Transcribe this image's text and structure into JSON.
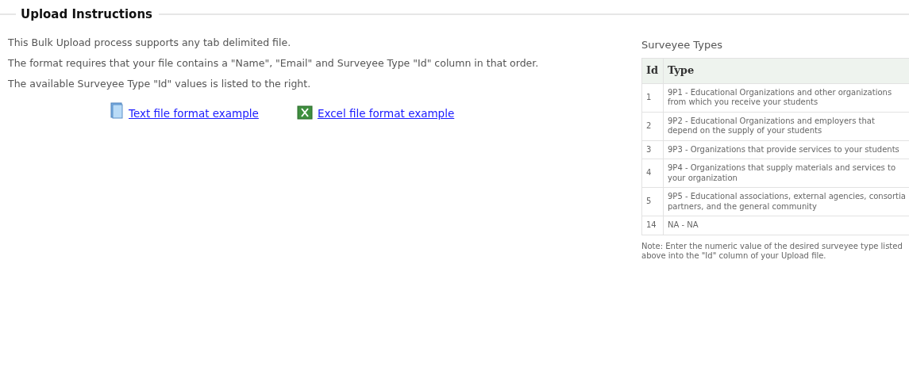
{
  "section": {
    "title": "Upload Instructions"
  },
  "instructions": [
    "This Bulk Upload process supports any tab delimited file.",
    "The format requires that your file contains a \"Name\", \"Email\" and Surveyee Type \"Id\" column in that order.",
    "The available Surveyee Type \"Id\" values is listed to the right."
  ],
  "links": [
    {
      "kind": "text",
      "label": "Text file format example"
    },
    {
      "kind": "excel",
      "label": "Excel file format example"
    }
  ],
  "surveyee_types": {
    "title": "Surveyee Types",
    "columns": [
      "Id",
      "Type"
    ],
    "rows": [
      [
        "1",
        "9P1 - Educational Organizations and other organizations from which you receive your students"
      ],
      [
        "2",
        "9P2 - Educational Organizations and employers that depend on the supply of your students"
      ],
      [
        "3",
        "9P3 - Organizations that provide services to your students"
      ],
      [
        "4",
        "9P4 - Organizations that supply materials and services to your organization"
      ],
      [
        "5",
        "9P5 - Educational associations, external agencies, consortia partners, and the general community"
      ],
      [
        "14",
        "NA - NA"
      ]
    ],
    "note": "Note: Enter the numeric value of the desired surveyee type listed above into the \"Id\" column of your Upload file."
  }
}
